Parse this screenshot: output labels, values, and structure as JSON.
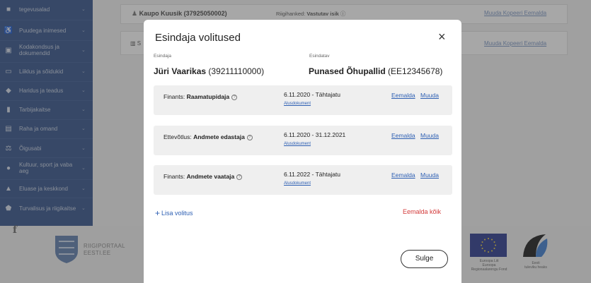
{
  "sidebar": {
    "items": [
      {
        "label": "tegevusalad",
        "icon": "briefcase-icon"
      },
      {
        "label": "Puudega inimesed",
        "icon": "accessibility-icon"
      },
      {
        "label": "Kodakondsus ja dokumendid",
        "icon": "passport-icon"
      },
      {
        "label": "Liiklus ja sõidukid",
        "icon": "car-icon"
      },
      {
        "label": "Haridus ja teadus",
        "icon": "graduation-cap-icon"
      },
      {
        "label": "Tarbijakaitse",
        "icon": "shopping-bag-icon"
      },
      {
        "label": "Raha ja omand",
        "icon": "money-icon"
      },
      {
        "label": "Õigusabi",
        "icon": "scales-icon"
      },
      {
        "label": "Kultuur, sport ja vaba aeg",
        "icon": "palette-icon"
      },
      {
        "label": "Eluase ja keskkond",
        "icon": "house-icon"
      },
      {
        "label": "Turvalisus ja riigikaitse",
        "icon": "shield-icon"
      }
    ]
  },
  "background": {
    "person": "Kaupo Kuusik (37925050002)",
    "role_label": "Riigihanked:",
    "role_value": "Vastutav isik",
    "actions": [
      "Muuda",
      "Kopeeri",
      "Eemalda"
    ],
    "second_initial": "S"
  },
  "footer": {
    "portal_line1": "RIIGIPORTAAL",
    "portal_line2": "EESTI.EE",
    "eu_line1": "Euroopa Liit",
    "eu_line2": "Euroopa",
    "eu_line3": "Regionaalarengu Fond",
    "est_line1": "Eesti",
    "est_line2": "tuleviku heaks"
  },
  "modal": {
    "title": "Esindaja volitused",
    "close_label": "×",
    "representative_label": "Esindaja",
    "representative_name": "Jüri Vaarikas",
    "representative_code": "(39211110000)",
    "represented_label": "Esindatav",
    "represented_name": "Punased Õhupallid",
    "represented_code": "(EE12345678)",
    "cards": [
      {
        "area": "Finants:",
        "role": "Raamatupidaja",
        "date": "6.11.2020 - Tähtajatu",
        "doc": "Alusdokument",
        "remove": "Eemalda",
        "change": "Muuda"
      },
      {
        "area": "Ettevõtlus:",
        "role": "Andmete edastaja",
        "date": "6.11.2020 - 31.12.2021",
        "doc": "Alusdokument",
        "remove": "Eemalda",
        "change": "Muuda"
      },
      {
        "area": "Finants:",
        "role": "Andmete vaataja",
        "date": "6.11.2022 - Tähtajatu",
        "doc": "Alusdokument",
        "remove": "Eemalda",
        "change": "Muuda"
      }
    ],
    "add_label": "Lisa volitus",
    "remove_all_label": "Eemalda kõik",
    "close_button": "Sulge"
  }
}
